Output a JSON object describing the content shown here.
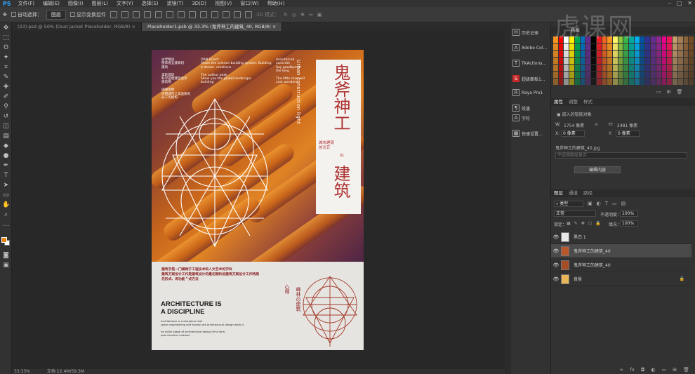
{
  "menubar": {
    "logo": "PS",
    "items": [
      "文件(F)",
      "编辑(E)",
      "图像(I)",
      "图层(L)",
      "文字(Y)",
      "选择(S)",
      "滤镜(T)",
      "3D(D)",
      "视图(V)",
      "窗口(W)",
      "帮助(H)"
    ]
  },
  "options": {
    "auto_select_label": "自动选择：",
    "auto_select_value": "图层",
    "show_transform_label": "显示变换控件",
    "mode_3d": "3D 模式："
  },
  "tabs": [
    {
      "label": "(23).psd @ 50% (Dust Jacket Placeholder, RGB/8)"
    },
    {
      "label": "Placeholder1.psb @ 33.3% (鬼斧神工的建筑_40, RGB/8)"
    }
  ],
  "status": {
    "zoom": "33.33%",
    "doc": "文档:12.4M/59.3M"
  },
  "poster": {
    "title_top": "鬼斧神工",
    "title_bottom": "建筑",
    "subtitle": "城市建筑的光芒",
    "subtitle_tag": "01",
    "vertical_en": "Urban construction light",
    "col1": [
      "古老略迹",
      "壁饰者全建筑机",
      "建筑",
      "",
      "美轮建筑",
      "科学是壁建造合手",
      "建筑物",
      "",
      "阔丽筑物",
      "点明城市之高品质的",
      "分工的结构"
    ],
    "col2": [
      "ORN Direct",
      "Share the science building system. Building",
      "a dream. emotions",
      "",
      "The author peak",
      "Show you the global landscape",
      "building"
    ],
    "col3": [
      "Areinforced",
      "concrete",
      "Say goodbye in",
      "the long",
      "",
      "The little man will",
      "cast wonders."
    ],
    "low_text": [
      "建筑学是一门横跨于工程技术和人文艺术的学科",
      "建筑方案设计工作是建筑设计的最初期阶段建筑方案设计工作特质",
      "先形式、再功能＂式方法"
    ],
    "arch_title_1": "ARCHITECTURE IS",
    "arch_title_2": "A DISCIPLINE",
    "arch_desc": [
      "Architecture is a discipline that",
      "spans engineering and human art.Architectural design work is",
      "",
      "he initial stage of architectural design.First form,",
      "post function method."
    ],
    "vert_a": "心得",
    "vert_b": "峰林の建筑"
  },
  "mid_panel": [
    {
      "icon": "H",
      "label": "历史记录",
      "icon_name": "history-icon"
    },
    {
      "icon": "A",
      "label": "Adobe Col...",
      "icon_name": "adobe-color-icon"
    },
    {
      "icon": "T",
      "label": "TKActions...",
      "icon_name": "tkactions-icon"
    },
    {
      "icon": "S",
      "label": "超级面板1...",
      "icon_name": "super-panel-icon"
    },
    {
      "icon": "R",
      "label": "Raya Pro1",
      "icon_name": "raya-icon"
    },
    {
      "icon": "¶",
      "label": "段落",
      "icon_name": "paragraph-icon"
    },
    {
      "icon": "A",
      "label": "字符",
      "icon_name": "character-icon"
    },
    {
      "icon": "▦",
      "label": "快速设置...",
      "icon_name": "quick-settings-icon"
    }
  ],
  "right": {
    "swatch_tab": "色板",
    "props_tabs": [
      "属性",
      "调整",
      "样式"
    ],
    "smart_object": "嵌入的智能对象",
    "w_label": "W:",
    "w_value": "1754 像素",
    "h_label": "H:",
    "h_value": "2481 像素",
    "x_label": "X:",
    "x_value": "0 像素",
    "y_label": "Y:",
    "y_value": "0 像素",
    "file": "鬼斧神工的建筑_40.jpg",
    "comp": "不适用图层复合",
    "edit_btn": "编辑内容",
    "layers_tabs": [
      "图层",
      "通道",
      "路径"
    ],
    "kind": "类型",
    "blend": "正常",
    "opacity_label": "不透明度：",
    "opacity": "100%",
    "lock_label": "锁定：",
    "fill_label": "填充：",
    "fill": "100%",
    "layers": [
      {
        "name": "黑白 1",
        "active": false,
        "thumb": "#e8e8e8"
      },
      {
        "name": "鬼斧神工的建筑_40",
        "active": true,
        "thumb": "#b8582a"
      },
      {
        "name": "鬼斧神工的建筑_40",
        "active": false,
        "thumb": "#a64d26"
      },
      {
        "name": "背景",
        "active": false,
        "thumb": "#e9b657"
      }
    ]
  },
  "swatch_colors": [
    "#f7931e",
    "#ff0000",
    "#ffffff",
    "#fff200",
    "#00a651",
    "#0072bc",
    "#662d91",
    "#000000",
    "#ed1c24",
    "#f26522",
    "#f7941d",
    "#fff568",
    "#8dc63f",
    "#39b54a",
    "#00a99d",
    "#00aeef",
    "#0054a6",
    "#2e3192",
    "#662d91",
    "#92278f",
    "#ec008c",
    "#ed145b",
    "#c69c6d",
    "#a67c52",
    "#8c6239",
    "#754c24"
  ],
  "watermark": "虎课网"
}
